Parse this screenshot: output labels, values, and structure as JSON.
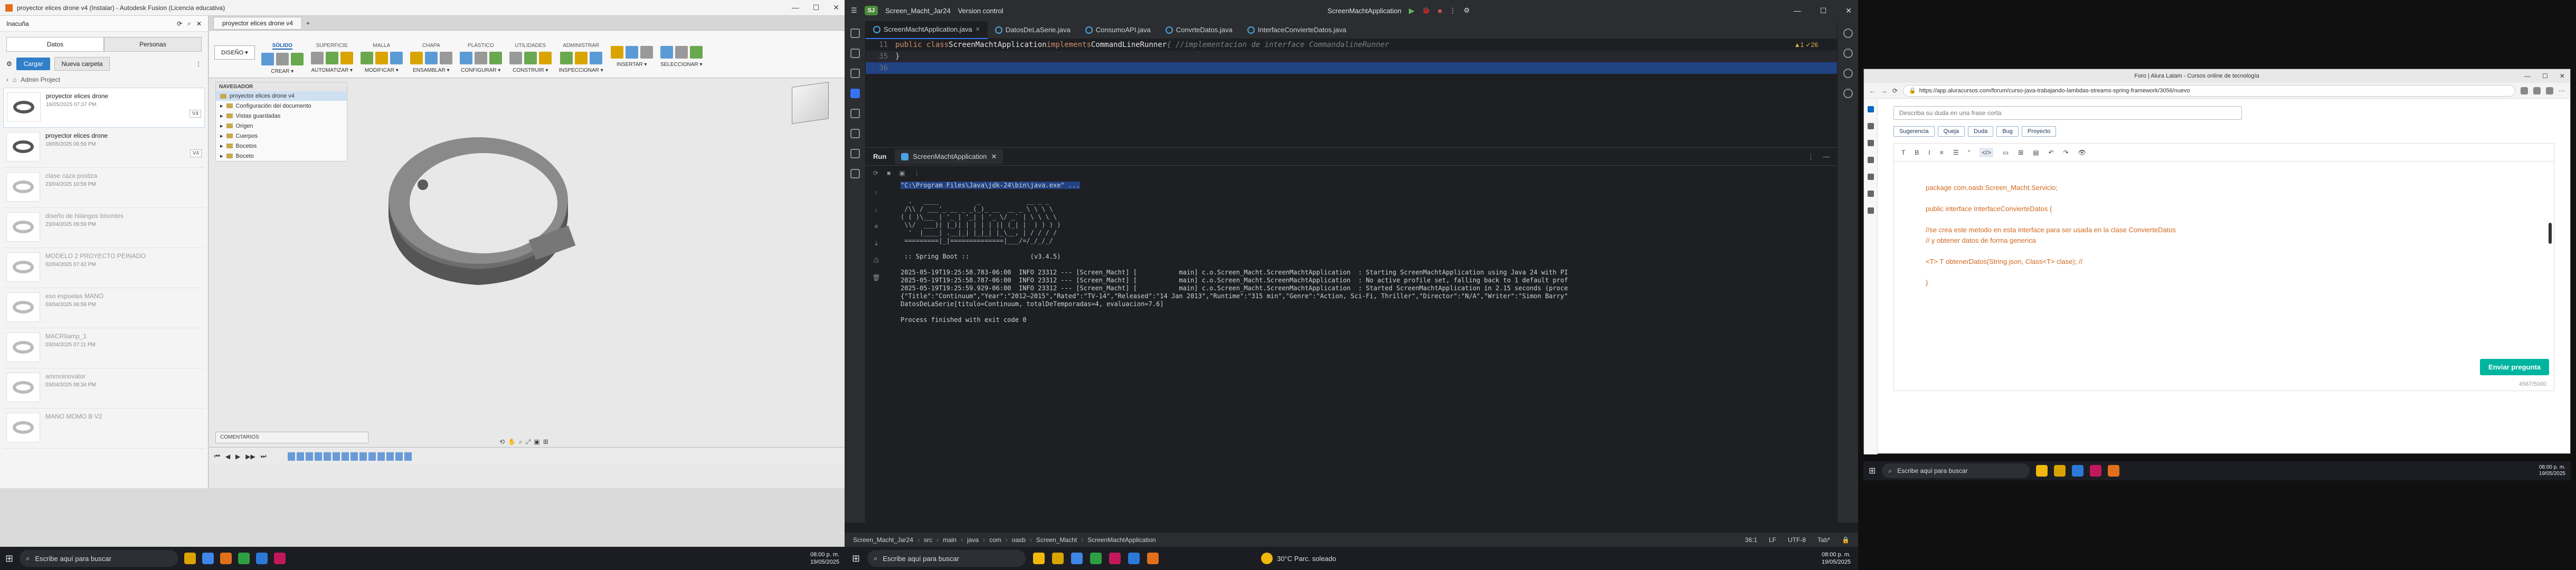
{
  "fusion": {
    "window_title": "proyector elices drone v4 (Instalar) - Autodesk Fusion (Licencia educativa)",
    "data_panel": {
      "user": "Inacuña",
      "tabs": [
        "Datos",
        "Personas"
      ],
      "upload_label": "Cargar",
      "new_folder_label": "Nueva carpeta",
      "breadcrumb": "Admin Project",
      "items": [
        {
          "name": "proyector elices drone",
          "date": "18/05/2025 07:37 PM",
          "version": "V4",
          "dim": false
        },
        {
          "name": "proyector elices drone",
          "date": "18/05/2025 06:59 PM",
          "version": "V4",
          "dim": false
        },
        {
          "name": "clase caza postiza",
          "date": "23/04/2025 10:59 PM",
          "version": "",
          "dim": true
        },
        {
          "name": "diseño de hilangos bisontes",
          "date": "23/04/2025 09:59 PM",
          "version": "",
          "dim": true
        },
        {
          "name": "MODELO 2 PROYECTO PEINADO",
          "date": "02/04/2025 07:42 PM",
          "version": "",
          "dim": true
        },
        {
          "name": "eso espuelas MANO",
          "date": "03/04/2025 06:59 PM",
          "version": "",
          "dim": true
        },
        {
          "name": "MACRIlamp_1",
          "date": "03/04/2025 07:11 PM",
          "version": "",
          "dim": true
        },
        {
          "name": "ammoinovator",
          "date": "03/04/2025 08:34 PM",
          "version": "",
          "dim": true
        },
        {
          "name": "MANO MOMO B V2",
          "date": "",
          "version": "",
          "dim": true
        }
      ]
    },
    "doc_tab": "proyector elices drone v4",
    "design_button": "DISEÑO ▾",
    "ribbon_tabs": [
      "SÓLIDO",
      "SUPERFICIE",
      "MALLA",
      "CHAPA",
      "PLÁSTICO",
      "UTILIDADES",
      "ADMINISTRAR"
    ],
    "ribbon_groups": [
      "CREAR ▾",
      "AUTOMATIZAR ▾",
      "MODIFICAR ▾",
      "ENSAMBLAR ▾",
      "CONFIGURAR ▾",
      "CONSTRUIR ▾",
      "INSPECCIONAR ▾",
      "INSERTAR ▾",
      "SELECCIONAR ▾"
    ],
    "browser": {
      "header": "NAVEGADOR",
      "root": "proyector elices drone v4",
      "rows": [
        "Configuración del documento",
        "Vistas guardadas",
        "Origen",
        "Cuerpos",
        "Bocetos",
        "Boceto"
      ]
    },
    "comments_label": "COMENTARIOS",
    "taskbar_search": "Escribe aquí para buscar",
    "clock_time": "08:00 p. m.",
    "clock_date": "19/05/2025"
  },
  "intellij": {
    "project_badge": "SJ",
    "project_name": "Screen_Macht_Jar24",
    "vcs_label": "Version control",
    "run_config": "ScreenMachtApplication",
    "tabs": [
      {
        "label": "ScreenMachtApplication.java",
        "active": true
      },
      {
        "label": "DatosDeLaSerie.java",
        "active": false
      },
      {
        "label": "ConsumoAPI.java",
        "active": false
      },
      {
        "label": "ConvrteDatos.java",
        "active": false
      },
      {
        "label": "InterfaceConvierteDatos.java",
        "active": false
      }
    ],
    "code": {
      "line11_num": "11",
      "line11_kw": "public class ",
      "line11_cls": "ScreenMachtApplication ",
      "line11_kw2": "implements ",
      "line11_iface": "CommandLineRunner ",
      "line11_cm": "{ //implementacion de interface CommandalineRunner",
      "line35_num": "35",
      "line35_txt": "}",
      "line36_num": "36",
      "warnings": "▲1 ✓26"
    },
    "run_title": "Run",
    "run_tab": "ScreenMachtApplication",
    "console": {
      "cmd": "\"C:\\Program Files\\Java\\jdk-24\\bin\\java.exe\" ...",
      "banner": "  .   ____          _            __ _ _\n /\\\\ / ___'_ __ _ _(_)_ __  __ _ \\ \\ \\ \\\n( ( )\\___ | '_ | '_| | '_ \\/ _` | \\ \\ \\ \\\n \\\\/  ___)| |_)| | | | | || (_| |  ) ) ) )\n  '  |____| .__|_| |_|_| |_\\__, | / / / /\n =========|_|==============|___/=/_/_/_/",
      "spring": " :: Spring Boot ::                (v3.4.5)",
      "log1": "2025-05-19T19:25:58.783-06:00  INFO 23312 --- [Screen_Macht] [           main] c.o.Screen_Macht.ScreenMachtApplication  : Starting ScreenMachtApplication using Java 24 with PI",
      "log2": "2025-05-19T19:25:58.787-06:00  INFO 23312 --- [Screen_Macht] [           main] c.o.Screen_Macht.ScreenMachtApplication  : No active profile set, falling back to 1 default prof",
      "log3": "2025-05-19T19:25:59.929-06:00  INFO 23312 --- [Screen_Macht] [           main] c.o.Screen_Macht.ScreenMachtApplication  : Started ScreenMachtApplication in 2.15 seconds (proce",
      "json": "{\"Title\":\"Continuum\",\"Year\":\"2012–2015\",\"Rated\":\"TV-14\",\"Released\":\"14 Jan 2013\",\"Runtime\":\"315 min\",\"Genre\":\"Action, Sci-Fi, Thriller\",\"Director\":\"N/A\",\"Writer\":\"Simon Barry\"",
      "record": "DatosDeLaSerie[titulo=Continuum, totalDeTemporadas=4, evaluacion=7.6]",
      "exit": "Process finished with exit code 0"
    },
    "status": {
      "path": [
        "Screen_Macht_Jar24",
        "src",
        "main",
        "java",
        "com",
        "oasb",
        "Screen_Macht",
        "ScreenMachtApplication"
      ],
      "pos": "36:1",
      "eol": "LF",
      "enc": "UTF-8",
      "indent": "Tab*"
    },
    "taskbar_search": "Escribe aquí para buscar",
    "weather": "30°C  Parc. soleado",
    "clock_time": "08:00 p. m.",
    "clock_date": "19/05/2025"
  },
  "browser": {
    "window_title": "Foro | Alura Latam - Cursos online de tecnología",
    "url": "https://app.aluracursos.com/forum/curso-java-trabajando-lambdas-streams-spring-framework/3056/nuevo",
    "summary_placeholder": "Describa su duda en una frase corta",
    "categories": [
      "Sugerencia",
      "Queja",
      "Duda",
      "Bug",
      "Proyecto"
    ],
    "toolbar": [
      "T",
      "B",
      "I",
      "≡",
      "☰",
      "“",
      "</>",
      "▭",
      "⊞",
      "▤",
      "↶",
      "↷",
      "👁"
    ],
    "code_lines": [
      "package com.oasb.Screen_Macht.Servicio;",
      "",
      "public interface InterfaceConvierteDatos {",
      "",
      "    //se crea este metodo en esta interface para ser usada en la clase ConvierteDatos",
      "    // y obtener datos de forma generica",
      "",
      "    <T> T obtenerDatos(String json, Class<T> clase); //",
      "",
      "}"
    ],
    "char_count": "4567/5000",
    "submit_label": "Enviar pregunta",
    "taskbar_search": "Escribe aquí para buscar",
    "clock_time": "08:00 p. m.",
    "clock_date": "19/05/2025"
  }
}
